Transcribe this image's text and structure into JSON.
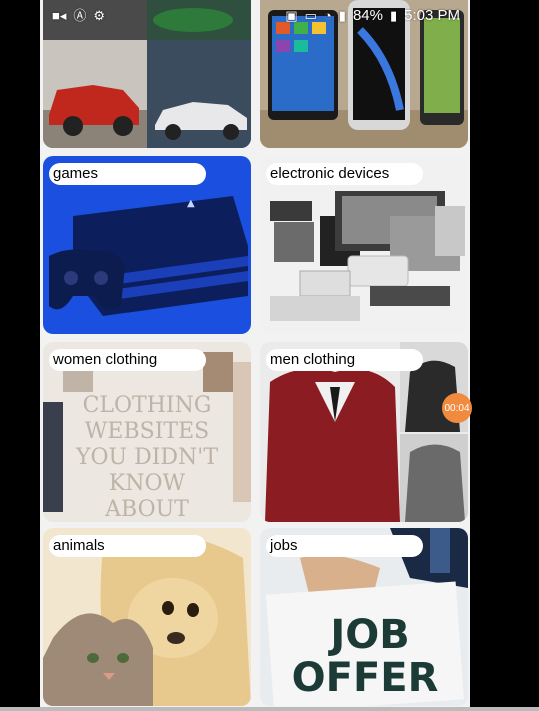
{
  "status_bar": {
    "battery": "84%",
    "time": "5:03 PM",
    "icons": [
      "video-icon",
      "a-icon",
      "settings-icon",
      "save-icon",
      "cast-icon",
      "wifi-icon",
      "signal-icon",
      "battery-icon"
    ]
  },
  "categories": [
    {
      "label": "",
      "image": "cars"
    },
    {
      "label": "",
      "image": "phones"
    },
    {
      "label": "games",
      "image": "game-console"
    },
    {
      "label": "electronic devices",
      "image": "electronics"
    },
    {
      "label": "women clothing",
      "image": "clothing-poster"
    },
    {
      "label": "men clothing",
      "image": "men-fashion"
    },
    {
      "label": "animals",
      "image": "puppy-kitten"
    },
    {
      "label": "jobs",
      "image": "job-offer"
    }
  ],
  "poster_text": "CLOTHING WEBSITES YOU DIDN'T KNOW ABOUT",
  "poster_lines": [
    "CLOTHING",
    "WEBSITES",
    "YOU DIDN'T",
    "KNOW",
    "ABOUT"
  ],
  "job_lines": [
    "JOB",
    "OFFER"
  ],
  "recording_timer": "00:04",
  "colors": {
    "background": "#f2f2f2",
    "card_label_bg": "#ffffff",
    "ps4_blue": "#1a4fe0",
    "record_badge": "#f08a3e"
  }
}
